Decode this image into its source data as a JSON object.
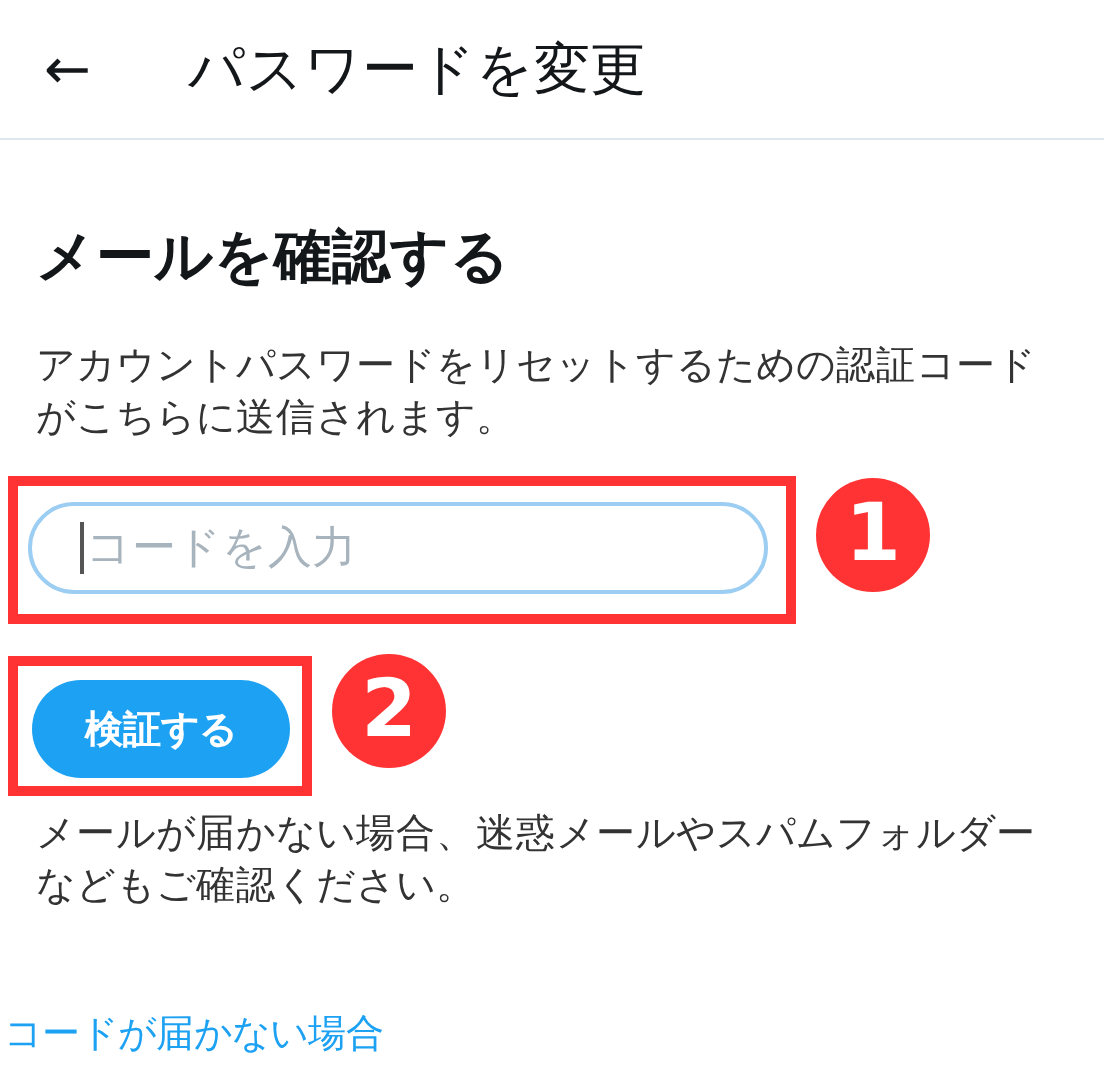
{
  "header": {
    "back_icon": "←",
    "title": "パスワードを変更"
  },
  "heading": "メールを確認する",
  "description": "アカウントパスワードをリセットするための認証コードがこちらに送信されます。",
  "code_field": {
    "placeholder": "コードを入力",
    "focused": true,
    "step": "1"
  },
  "verify_button": {
    "label": "検証する",
    "step": "2"
  },
  "note": "メールが届かない場合、迷惑メールやスパムフォルダーなどもご確認ください。",
  "link": "コードが届かない場合"
}
